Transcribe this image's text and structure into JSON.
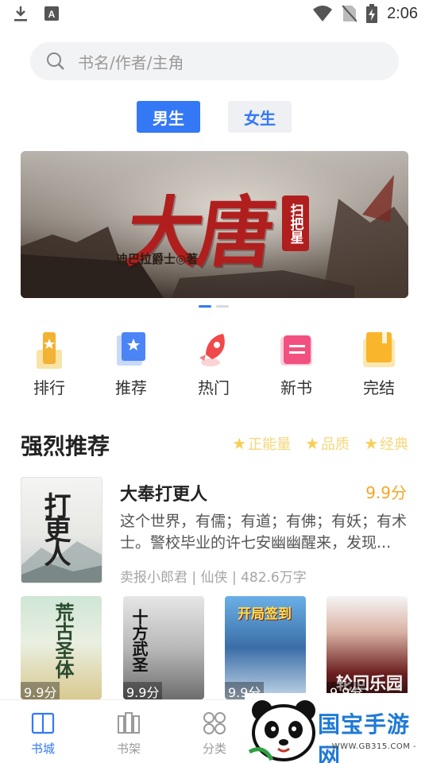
{
  "status_bar": {
    "time": "2:06"
  },
  "search": {
    "placeholder": "书名/作者/主角"
  },
  "gender_tabs": [
    {
      "label": "男生",
      "selected": true
    },
    {
      "label": "女生",
      "selected": false
    }
  ],
  "banner": {
    "title": "大唐",
    "seal": "扫把星",
    "author": "迪巴拉爵士◎著",
    "page_index": 1,
    "page_count": 2
  },
  "quick_nav": [
    {
      "label": "排行",
      "icon": "rank-icon"
    },
    {
      "label": "推荐",
      "icon": "recommend-icon"
    },
    {
      "label": "热门",
      "icon": "rocket-icon"
    },
    {
      "label": "新书",
      "icon": "new-book-icon"
    },
    {
      "label": "完结",
      "icon": "completed-icon"
    }
  ],
  "section": {
    "title": "强烈推荐",
    "tags": [
      "正能量",
      "品质",
      "经典"
    ]
  },
  "featured_book": {
    "title": "大奉打更人",
    "score": "9.9分",
    "description": "这个世界，有儒；有道；有佛；有妖；有术士。警校毕业的许七安幽幽醒来，发现...",
    "meta": "卖报小郎君 | 仙侠 | 482.6万字",
    "cover_text": "打更人"
  },
  "cover_row": [
    {
      "cover_text": "荒古圣体",
      "score": "9.9分"
    },
    {
      "cover_text": "十方武圣",
      "score": "9.9分"
    },
    {
      "cover_text": "开局签到",
      "score": "9.9分"
    },
    {
      "cover_text": "轮回乐园",
      "score": "9.9分"
    }
  ],
  "bottom_nav": [
    {
      "label": "书城",
      "active": true
    },
    {
      "label": "书架",
      "active": false
    },
    {
      "label": "分类",
      "active": false
    }
  ],
  "watermark": {
    "text": "国宝手游网",
    "url": "- WWW.GB315.COM -"
  },
  "colors": {
    "accent": "#3478f6",
    "score": "#f5a623",
    "tag": "#f6d77a"
  }
}
